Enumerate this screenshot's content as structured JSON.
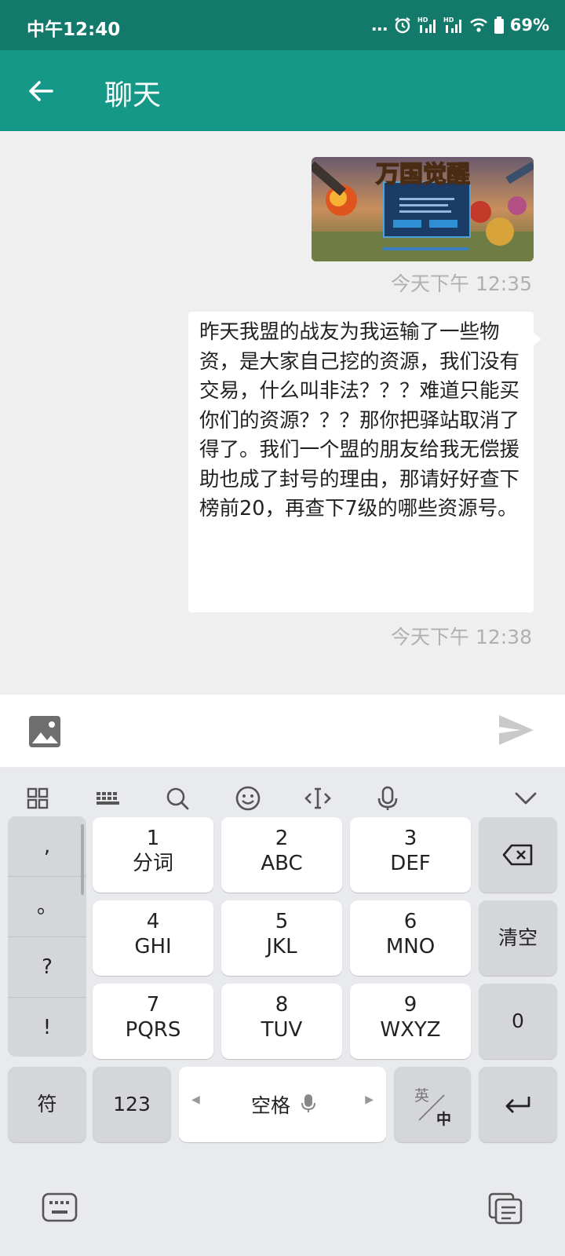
{
  "status": {
    "time": "中午12:40",
    "dots": "...",
    "battery": "69%"
  },
  "appbar": {
    "title": "聊天"
  },
  "messages": [
    {
      "type": "image",
      "time": "今天下午 12:35"
    },
    {
      "type": "text",
      "text": "昨天我盟的战友为我运输了一些物资，是大家自己挖的资源，我们没有交易，什么叫非法？？？难道只能买你们的资源？？？那你把驿站取消了得了。我们一个盟的朋友给我无偿援助也成了封号的理由，那请好好查下榜前20，再查下7级的哪些资源号。",
      "time": "今天下午 12:38"
    }
  ],
  "game_image": {
    "logo_text": "万国觉醒"
  },
  "keyboard": {
    "punct": [
      ",",
      "。",
      "?",
      "!"
    ],
    "keys": [
      {
        "num": "1",
        "letters": "分词"
      },
      {
        "num": "2",
        "letters": "ABC"
      },
      {
        "num": "3",
        "letters": "DEF"
      },
      {
        "num": "4",
        "letters": "GHI"
      },
      {
        "num": "5",
        "letters": "JKL"
      },
      {
        "num": "6",
        "letters": "MNO"
      },
      {
        "num": "7",
        "letters": "PQRS"
      },
      {
        "num": "8",
        "letters": "TUV"
      },
      {
        "num": "9",
        "letters": "WXYZ"
      }
    ],
    "clear": "清空",
    "zero": "0",
    "symbol": "符",
    "numeric": "123",
    "space": "空格",
    "lang_en": "英",
    "lang_zh": "中"
  }
}
